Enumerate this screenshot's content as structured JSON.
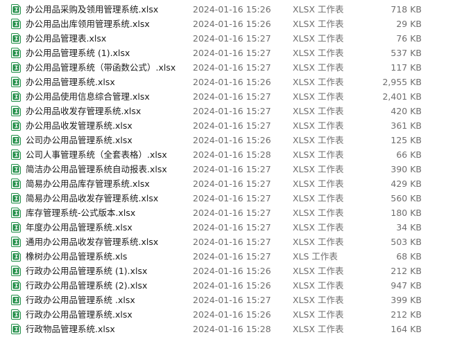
{
  "accent_color": "#1e8c45",
  "file_icon": "excel-spreadsheet-icon",
  "files": [
    {
      "name": "办公用品采购及领用管理系统.xlsx",
      "modified": "2024-01-16 15:26",
      "type": "XLSX 工作表",
      "size": "718 KB"
    },
    {
      "name": "办公用品出库领用管理系统.xlsx",
      "modified": "2024-01-16 15:26",
      "type": "XLSX 工作表",
      "size": "29 KB"
    },
    {
      "name": "办公用品管理表.xlsx",
      "modified": "2024-01-16 15:27",
      "type": "XLSX 工作表",
      "size": "76 KB"
    },
    {
      "name": "办公用品管理系统 (1).xlsx",
      "modified": "2024-01-16 15:27",
      "type": "XLSX 工作表",
      "size": "537 KB"
    },
    {
      "name": "办公用品管理系统（带函数公式）.xlsx",
      "modified": "2024-01-16 15:27",
      "type": "XLSX 工作表",
      "size": "117 KB"
    },
    {
      "name": "办公用品管理系统.xlsx",
      "modified": "2024-01-16 15:26",
      "type": "XLSX 工作表",
      "size": "2,955 KB"
    },
    {
      "name": "办公用品使用信息综合管理.xlsx",
      "modified": "2024-01-16 15:27",
      "type": "XLSX 工作表",
      "size": "2,401 KB"
    },
    {
      "name": "办公用品收发存管理系统.xlsx",
      "modified": "2024-01-16 15:27",
      "type": "XLSX 工作表",
      "size": "420 KB"
    },
    {
      "name": "办公用品收发管理系统.xlsx",
      "modified": "2024-01-16 15:27",
      "type": "XLSX 工作表",
      "size": "361 KB"
    },
    {
      "name": "公司办公用品管理系统.xlsx",
      "modified": "2024-01-16 15:26",
      "type": "XLSX 工作表",
      "size": "125 KB"
    },
    {
      "name": "公司人事管理系统（全套表格）.xlsx",
      "modified": "2024-01-16 15:28",
      "type": "XLSX 工作表",
      "size": "66 KB"
    },
    {
      "name": "简洁办公用品管理系统自动报表.xlsx",
      "modified": "2024-01-16 15:27",
      "type": "XLSX 工作表",
      "size": "390 KB"
    },
    {
      "name": "简易办公用品库存管理系统.xlsx",
      "modified": "2024-01-16 15:27",
      "type": "XLSX 工作表",
      "size": "429 KB"
    },
    {
      "name": "简易办公用品收发存管理系统.xlsx",
      "modified": "2024-01-16 15:27",
      "type": "XLSX 工作表",
      "size": "560 KB"
    },
    {
      "name": "库存管理系统-公式版本.xlsx",
      "modified": "2024-01-16 15:27",
      "type": "XLSX 工作表",
      "size": "180 KB"
    },
    {
      "name": "年度办公用品管理系统.xlsx",
      "modified": "2024-01-16 15:27",
      "type": "XLSX 工作表",
      "size": "34 KB"
    },
    {
      "name": "通用办公用品收发存管理系统.xlsx",
      "modified": "2024-01-16 15:27",
      "type": "XLSX 工作表",
      "size": "503 KB"
    },
    {
      "name": "橡树办公用品管理系统.xls",
      "modified": "2024-01-16 15:27",
      "type": "XLS 工作表",
      "size": "68 KB"
    },
    {
      "name": "行政办公用品管理系统 (1).xlsx",
      "modified": "2024-01-16 15:26",
      "type": "XLSX 工作表",
      "size": "212 KB"
    },
    {
      "name": "行政办公用品管理系统 (2).xlsx",
      "modified": "2024-01-16 15:26",
      "type": "XLSX 工作表",
      "size": "947 KB"
    },
    {
      "name": "行政办公用品管理系统 .xlsx",
      "modified": "2024-01-16 15:27",
      "type": "XLSX 工作表",
      "size": "399 KB"
    },
    {
      "name": "行政办公用品管理系统.xlsx",
      "modified": "2024-01-16 15:26",
      "type": "XLSX 工作表",
      "size": "212 KB"
    },
    {
      "name": "行政物品管理系统.xlsx",
      "modified": "2024-01-16 15:28",
      "type": "XLSX 工作表",
      "size": "164 KB"
    }
  ]
}
